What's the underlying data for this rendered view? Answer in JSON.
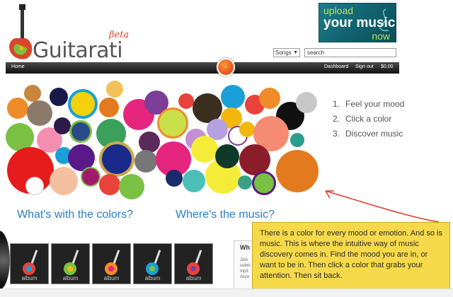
{
  "header": {
    "logo_text": "Guitarati",
    "beta_label": "βeta",
    "upload": {
      "line1": "upload",
      "line2": "your music",
      "line3": "now"
    },
    "search": {
      "category": "Songs",
      "query": "search"
    }
  },
  "nav": {
    "home": "Home",
    "dashboard": "Dashboard",
    "sign_out": "Sign out",
    "cart": "$0.00"
  },
  "circle_colors": [
    "#e8433a",
    "#f3b70c",
    "#1a9fd8",
    "#7ac143",
    "#e5257e",
    "#7b3f98",
    "#f08b2a",
    "#8b1c2a",
    "#2a9d8f",
    "#ff6f61"
  ],
  "steps": [
    {
      "num": "1.",
      "text": "Feel your mood"
    },
    {
      "num": "2.",
      "text": "Click a color"
    },
    {
      "num": "3.",
      "text": "Discover music"
    }
  ],
  "links": {
    "colors": "What's with the colors?",
    "music": "Where's the music?"
  },
  "albums": [
    "album",
    "album",
    "album",
    "album",
    "album"
  ],
  "side_panel": {
    "title": "Wh",
    "lines": [
      "Join",
      "subm",
      "mp3",
      "Acce"
    ]
  },
  "callout": "There is a color for every mood or emotion. And so is music.  This is where the intuitive way of music discovery comes in. Find the mood you are in, or want to be in. Then click a color that grabs your attention. Then sit back."
}
